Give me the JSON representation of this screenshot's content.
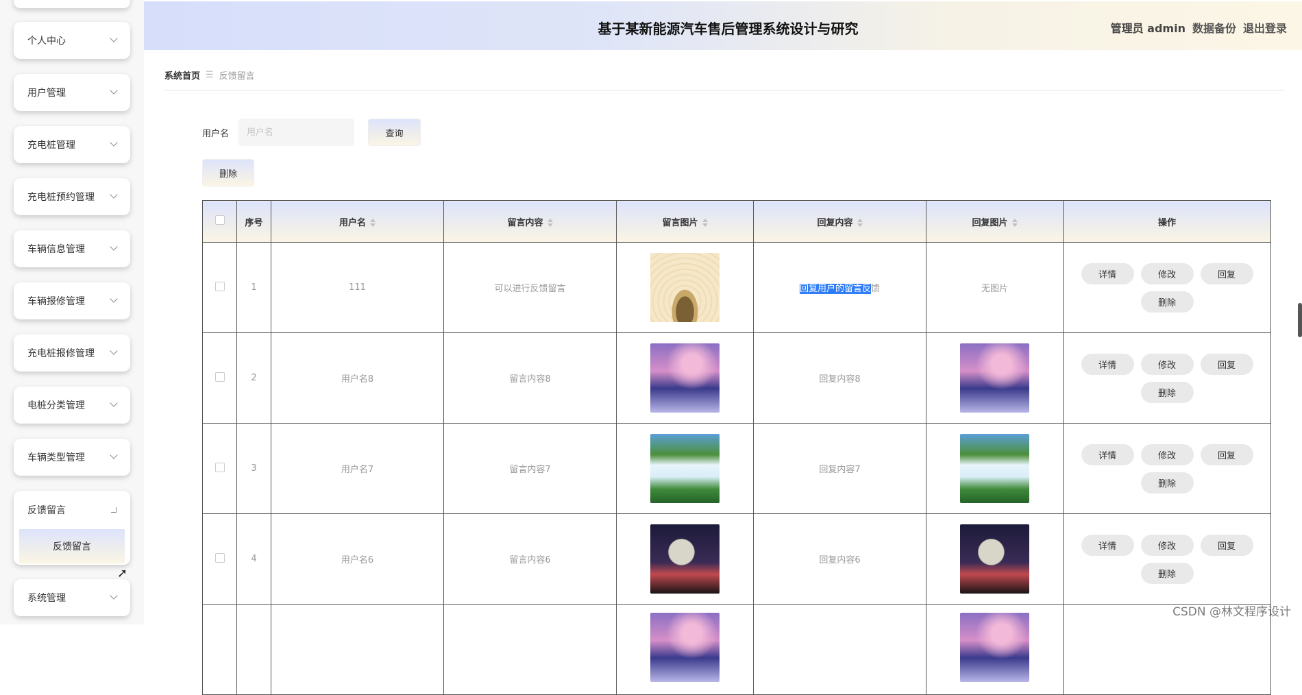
{
  "sidebar": {
    "items": [
      {
        "label": "个人中心"
      },
      {
        "label": "用户管理"
      },
      {
        "label": "充电桩管理"
      },
      {
        "label": "充电桩预约管理"
      },
      {
        "label": "车辆信息管理"
      },
      {
        "label": "车辆报修管理"
      },
      {
        "label": "充电桩报修管理"
      },
      {
        "label": "电桩分类管理"
      },
      {
        "label": "车辆类型管理"
      }
    ],
    "open_item": {
      "label": "反馈留言",
      "sub": "反馈留言"
    },
    "last_item": {
      "label": "系统管理"
    }
  },
  "header": {
    "title": "基于某新能源汽车售后管理系统设计与研究",
    "user": "管理员 admin",
    "backup": "数据备份",
    "logout": "退出登录"
  },
  "breadcrumb": {
    "home": "系统首页",
    "sep": "☰",
    "current": "反馈留言"
  },
  "search": {
    "label": "用户名",
    "placeholder": "用户名",
    "query": "查询",
    "delete": "删除"
  },
  "table": {
    "headers": {
      "index": "序号",
      "username": "用户名",
      "content": "留言内容",
      "image": "留言图片",
      "reply": "回复内容",
      "reply_image": "回复图片",
      "ops": "操作"
    },
    "rows": [
      {
        "index": "1",
        "username": "111",
        "content": "可以进行反馈留言",
        "reply_hl": "回复用户的留言反",
        "reply_rest": "馈",
        "reply_image": "无图片"
      },
      {
        "index": "2",
        "username": "用户名8",
        "content": "留言内容8",
        "reply": "回复内容8"
      },
      {
        "index": "3",
        "username": "用户名7",
        "content": "留言内容7",
        "reply": "回复内容7"
      },
      {
        "index": "4",
        "username": "用户名6",
        "content": "留言内容6",
        "reply": "回复内容6"
      }
    ],
    "ops": {
      "detail": "详情",
      "edit": "修改",
      "reply": "回复",
      "delete": "删除"
    }
  },
  "watermark": "CSDN @林文程序设计"
}
